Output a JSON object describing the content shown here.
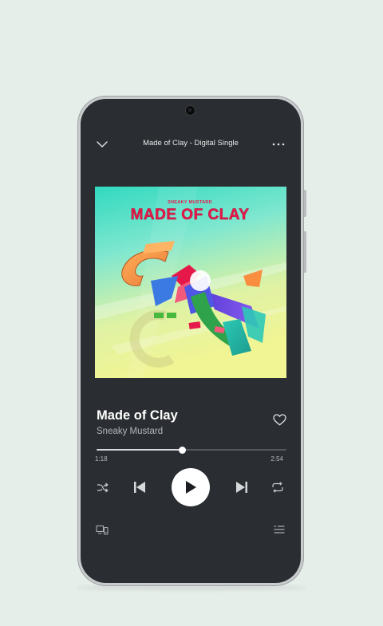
{
  "header": {
    "title": "Made of Clay - Digital Single",
    "collapse_icon": "chevron-down-icon",
    "menu_icon": "more-horizontal-icon"
  },
  "album": {
    "cover_brand": "SNEAKY MUSTARD",
    "cover_title": "MADE OF CLAY"
  },
  "track": {
    "title": "Made of Clay",
    "artist": "Sneaky Mustard",
    "favorite_icon": "heart-outline-icon"
  },
  "playback": {
    "elapsed": "1:18",
    "duration": "2:54",
    "progress_fraction": 0.45,
    "state": "paused"
  },
  "controls": {
    "shuffle_icon": "shuffle-icon",
    "previous_icon": "skip-previous-icon",
    "play_icon": "play-icon",
    "next_icon": "skip-next-icon",
    "repeat_icon": "repeat-icon"
  },
  "footer": {
    "devices_icon": "connect-devices-icon",
    "queue_icon": "queue-icon"
  },
  "colors": {
    "page_background": "#e6eeea",
    "screen_background": "#2a2d31",
    "cover_title_color": "#e8194a",
    "accent_white": "#ffffff",
    "muted_text": "#b4b7ba"
  }
}
